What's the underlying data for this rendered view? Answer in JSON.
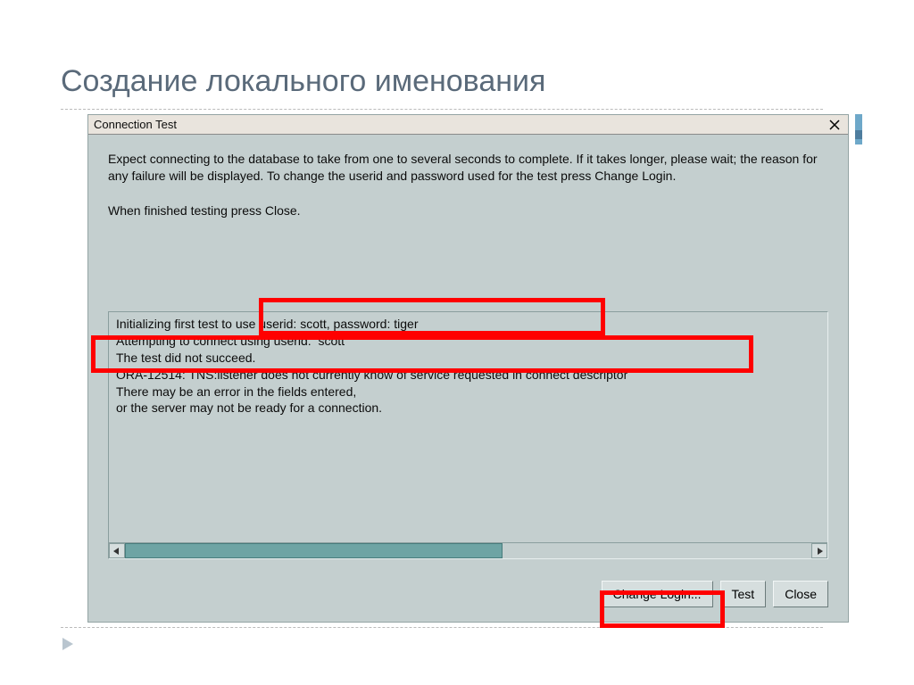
{
  "slide": {
    "title": "Создание локального именования"
  },
  "dialog": {
    "title": "Connection Test",
    "instructions_line1": "Expect connecting to the database to take from one to several seconds to complete. If it takes longer, please wait; the reason for any failure will be displayed. To change the userid and password used for the test press Change Login.",
    "instructions_line2": "When finished testing press Close.",
    "log": {
      "l1": "Initializing first test to use userid: scott, password: tiger",
      "l2": "Attempting to connect using userid:  scott",
      "l3": "The test did not succeed.",
      "l4": "ORA-12514: TNS:listener does not currently know of service requested in connect descriptor",
      "l5": "",
      "l6": "There may be an error in the fields entered,",
      "l7": "or the server may not be ready for a connection."
    },
    "buttons": {
      "change_login": "Change Login...",
      "test": "Test",
      "close": "Close"
    }
  }
}
